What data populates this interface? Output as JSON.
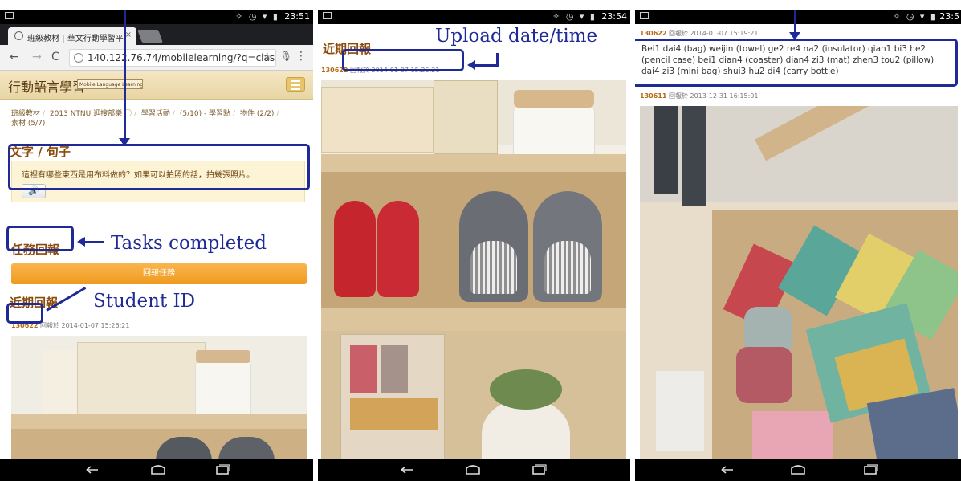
{
  "panels": [
    {
      "status": {
        "time": "23:51",
        "icons": "✧ ◷ ▾ ▮"
      },
      "tab": {
        "title": "班級教材 | 華文行動學習平",
        "close": "×"
      },
      "url": "140.122.76.74/mobilelearning/?q=clas",
      "site": {
        "title": "行動語言學習",
        "subtitle": "Mobile Language Learning"
      },
      "breadcrumb": [
        "班級教材",
        "2013 NTNU 逛搜部樂 ⓘ",
        "學習活動",
        "(5/10) - 學習點",
        "物件 (2/2)",
        "素材 (5/7)"
      ],
      "text_heading": "文字 / 句子",
      "prompt": "這裡有哪些東西是用布料做的？如果可以拍照的話，拍幾張照片。",
      "speaker_icon": "🔊",
      "tasks_heading": "任務回報",
      "report_button": "回報任務",
      "recent_heading": "近期回報",
      "report": {
        "student_id": "130622",
        "label": "回報於",
        "datetime": "2014-01-07 15:26:21"
      },
      "annotations": {
        "tasks_completed": "Tasks completed",
        "student_id": "Student ID"
      }
    },
    {
      "status": {
        "time": "23:54",
        "icons": "✧ ◷ ▾ ▮"
      },
      "recent_heading": "近期回報",
      "report": {
        "student_id": "130622",
        "label": "回報於",
        "datetime": "2014-01-07 15:26:21"
      },
      "annotations": {
        "upload": "Upload date/time"
      }
    },
    {
      "status": {
        "time": "23:5",
        "icons": "✧ ◷ ▾ ▮"
      },
      "report1": {
        "student_id": "130622",
        "label": "回報於",
        "datetime": "2014-01-07 15:19:21"
      },
      "caption": "Bei1 dai4 (bag) weijin (towel) ge2 re4 na2 (insulator) qian1 bi3 he2 (pencil case) bei1 dian4 (coaster) dian4 zi3 (mat) zhen3 tou2 (pillow) dai4 zi3 (mini bag) shui3 hu2 di4 (carry bottle)",
      "report2": {
        "student_id": "130611",
        "label": "回報於",
        "datetime": "2013-12-31 16:15:01"
      }
    }
  ],
  "colors": {
    "annotation": "#1f2a96",
    "heading": "#8a4a0a",
    "button": "#ef9a1f"
  }
}
